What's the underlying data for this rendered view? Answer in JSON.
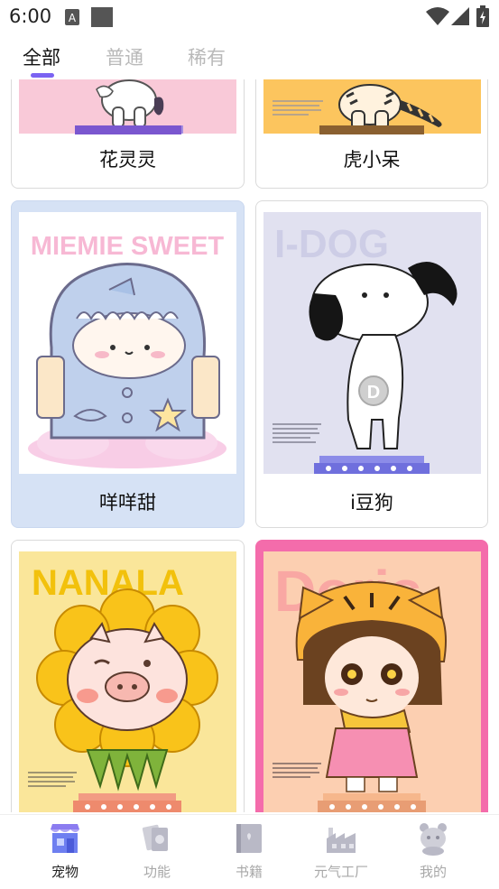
{
  "status_bar": {
    "time": "6:00"
  },
  "tabs": [
    {
      "label": "全部",
      "active": true
    },
    {
      "label": "普通",
      "active": false
    },
    {
      "label": "稀有",
      "active": false
    }
  ],
  "pets": [
    {
      "name": "花灵灵"
    },
    {
      "name": "虎小呆"
    },
    {
      "name": "咩咩甜",
      "poster_title": "MIEMIE SWEET"
    },
    {
      "name": "i豆狗",
      "poster_title": "I-DOG",
      "badge": "D"
    },
    {
      "name": "",
      "poster_title": "NANALA"
    },
    {
      "name": "",
      "poster_title": "Doris"
    }
  ],
  "nav": [
    {
      "label": "宠物",
      "icon": "pet-shop-icon",
      "active": true
    },
    {
      "label": "功能",
      "icon": "cards-icon",
      "active": false
    },
    {
      "label": "书籍",
      "icon": "book-icon",
      "active": false
    },
    {
      "label": "元气工厂",
      "icon": "factory-icon",
      "active": false
    },
    {
      "label": "我的",
      "icon": "profile-icon",
      "active": false
    }
  ],
  "colors": {
    "accent": "#7b62f2",
    "blue_card": "#d6e2f5",
    "pink_card": "#f46cab"
  }
}
